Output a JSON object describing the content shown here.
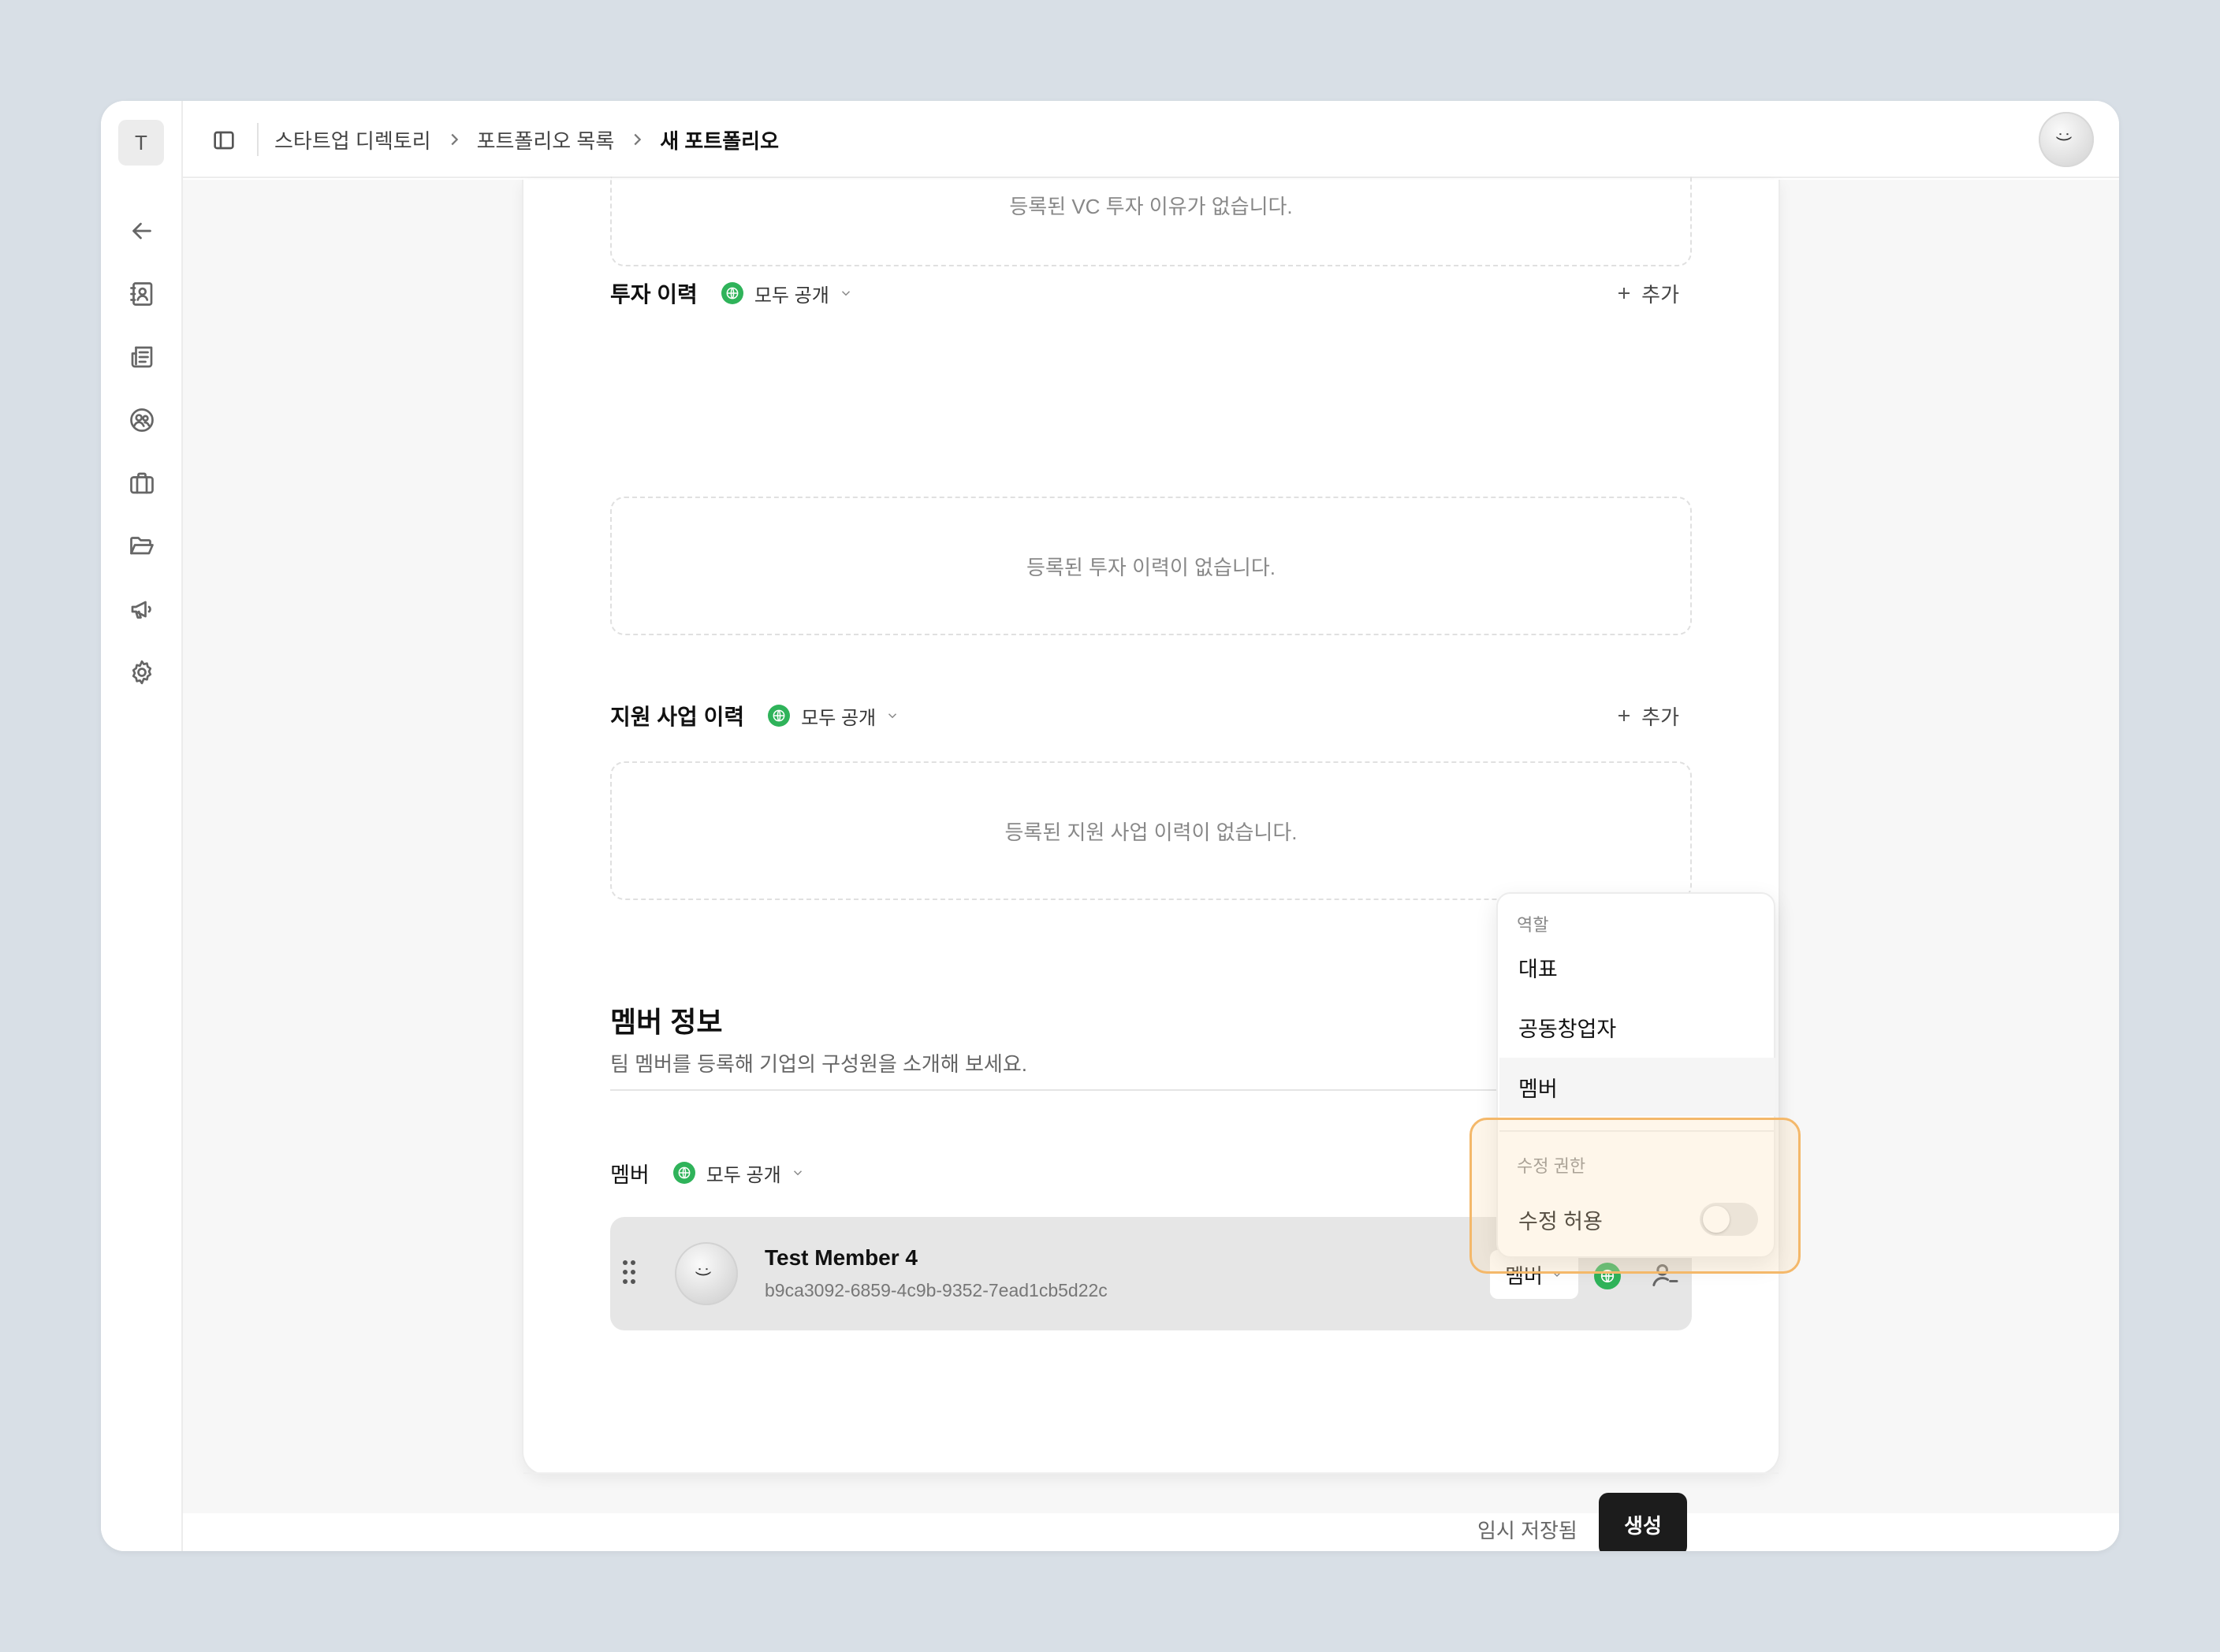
{
  "workspace_initial": "T",
  "breadcrumb": {
    "items": [
      "스타트업 디렉토리",
      "포트폴리오 목록",
      "새 포트폴리오"
    ]
  },
  "sections": {
    "vc_reasons_empty": "등록된 VC 투자 이유가 없습니다.",
    "investment": {
      "title": "투자 이력",
      "visibility": "모두 공개",
      "add_label": "추가",
      "empty": "등록된 투자 이력이 없습니다."
    },
    "support": {
      "title": "지원 사업 이력",
      "visibility": "모두 공개",
      "add_label": "추가",
      "empty": "등록된 지원 사업 이력이 없습니다."
    }
  },
  "members": {
    "heading": "멤버 정보",
    "description": "팀 멤버를 등록해 기업의 구성원을 소개해 보세요.",
    "list_title": "멤버",
    "visibility": "모두 공개",
    "card": {
      "name": "Test Member 4",
      "id": "b9ca3092-6859-4c9b-9352-7ead1cb5d22c",
      "role": "멤버"
    }
  },
  "role_menu": {
    "role_label": "역할",
    "roles": [
      "대표",
      "공동창업자",
      "멤버"
    ],
    "selected_role": "멤버",
    "permission_label": "수정 권한",
    "permission_item": "수정 허용",
    "permission_enabled": false
  },
  "footer": {
    "draft_status": "임시 저장됨",
    "create_label": "생성"
  },
  "colors": {
    "public_green": "#2fb35a",
    "primary_button": "#1c1c1c",
    "highlight_orange": "#f4b86a"
  },
  "icons": {
    "rail": [
      "back-arrow-icon",
      "contacts-icon",
      "newspaper-icon",
      "users-circle-icon",
      "briefcase-icon",
      "folder-open-icon",
      "megaphone-icon",
      "gear-icon"
    ]
  }
}
